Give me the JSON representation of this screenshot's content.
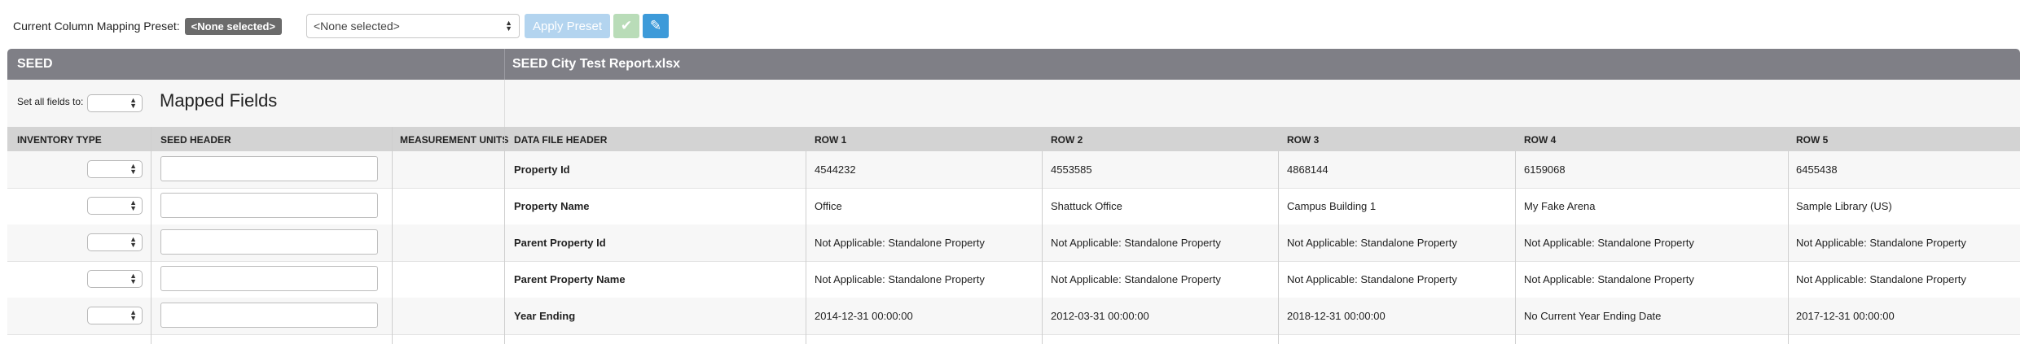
{
  "preset": {
    "label": "Current Column Mapping Preset:",
    "current_badge": "<None selected>",
    "select_value": "<None selected>",
    "apply_label": "Apply Preset"
  },
  "panel": {
    "seed_title": "SEED",
    "file_title": "SEED City Test Report.xlsx",
    "set_all_label": "Set all fields to:",
    "mapped_fields_title": "Mapped Fields"
  },
  "columns": {
    "inventory_type": "INVENTORY TYPE",
    "seed_header": "SEED HEADER",
    "measurement_units": "MEASUREMENT UNITS",
    "data_file_header": "DATA FILE HEADER",
    "row1": "ROW 1",
    "row2": "ROW 2",
    "row3": "ROW 3",
    "row4": "ROW 4",
    "row5": "ROW 5"
  },
  "rows": [
    {
      "header": "Property Id",
      "r1": "4544232",
      "r2": "4553585",
      "r3": "4868144",
      "r4": "6159068",
      "r5": "6455438"
    },
    {
      "header": "Property Name",
      "r1": "Office",
      "r2": "Shattuck Office",
      "r3": "Campus Building 1",
      "r4": "My Fake Arena",
      "r5": "Sample Library (US)"
    },
    {
      "header": "Parent Property Id",
      "r1": "Not Applicable: Standalone Property",
      "r2": "Not Applicable: Standalone Property",
      "r3": "Not Applicable: Standalone Property",
      "r4": "Not Applicable: Standalone Property",
      "r5": "Not Applicable: Standalone Property"
    },
    {
      "header": "Parent Property Name",
      "r1": "Not Applicable: Standalone Property",
      "r2": "Not Applicable: Standalone Property",
      "r3": "Not Applicable: Standalone Property",
      "r4": "Not Applicable: Standalone Property",
      "r5": "Not Applicable: Standalone Property"
    },
    {
      "header": "Year Ending",
      "r1": "2014-12-31 00:00:00",
      "r2": "2012-03-31 00:00:00",
      "r3": "2018-12-31 00:00:00",
      "r4": "No Current Year Ending Date",
      "r5": "2017-12-31 00:00:00"
    }
  ],
  "icons": {
    "check": "check-icon",
    "edit": "pencil-icon",
    "select_arrows": "up-down-arrows-icon"
  },
  "colors": {
    "header_bar": "#7f7f86",
    "apply_button": "#b3d4ef",
    "check_button": "#b9dcb8",
    "edit_button": "#3d9ad9",
    "badge": "#6b6b6b"
  }
}
